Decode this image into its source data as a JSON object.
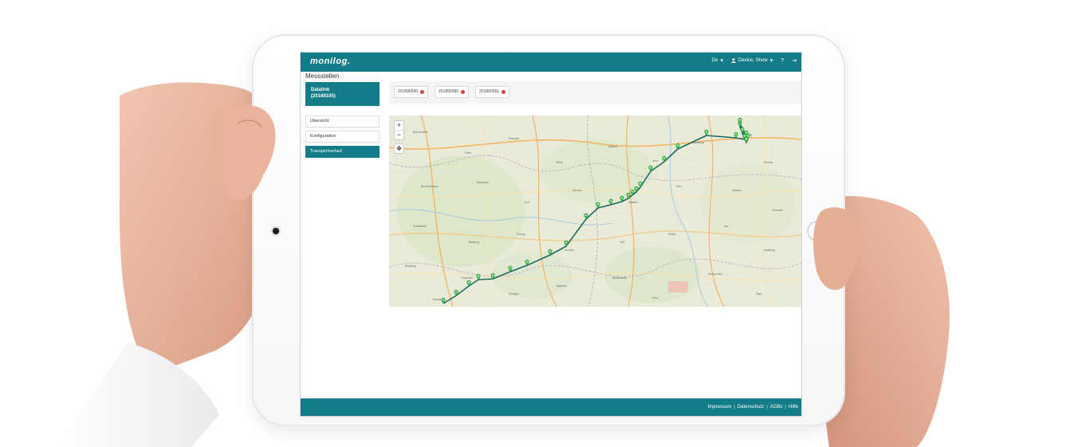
{
  "app": {
    "logo": "monilog.",
    "page_title": "Messstellen"
  },
  "topbar": {
    "language": "De",
    "language_chevron": "▾",
    "user": "Device, Show",
    "user_chevron": "▾",
    "help_icon": "?",
    "logout_icon": "⇥"
  },
  "sidebar": {
    "device_title": "Datalink",
    "device_id": "(20168105)",
    "items": [
      {
        "label": "Übersicht",
        "active": false
      },
      {
        "label": "Konfiguration",
        "active": false
      },
      {
        "label": "Transportverlauf",
        "active": true
      }
    ]
  },
  "tabs": [
    {
      "label": "201890260"
    },
    {
      "label": "201890580"
    },
    {
      "label": "201890581"
    }
  ],
  "map": {
    "zoom_in": "+",
    "zoom_out": "−",
    "locate": "✥",
    "route_color": "#1e6b62",
    "marker_color": "#3fc34f"
  },
  "footer": {
    "links": [
      "Impressum",
      "Datenschutz",
      "AGBs",
      "Hilfe"
    ],
    "separator": "|"
  },
  "colors": {
    "brand": "#137c88",
    "alert": "#d64545"
  }
}
